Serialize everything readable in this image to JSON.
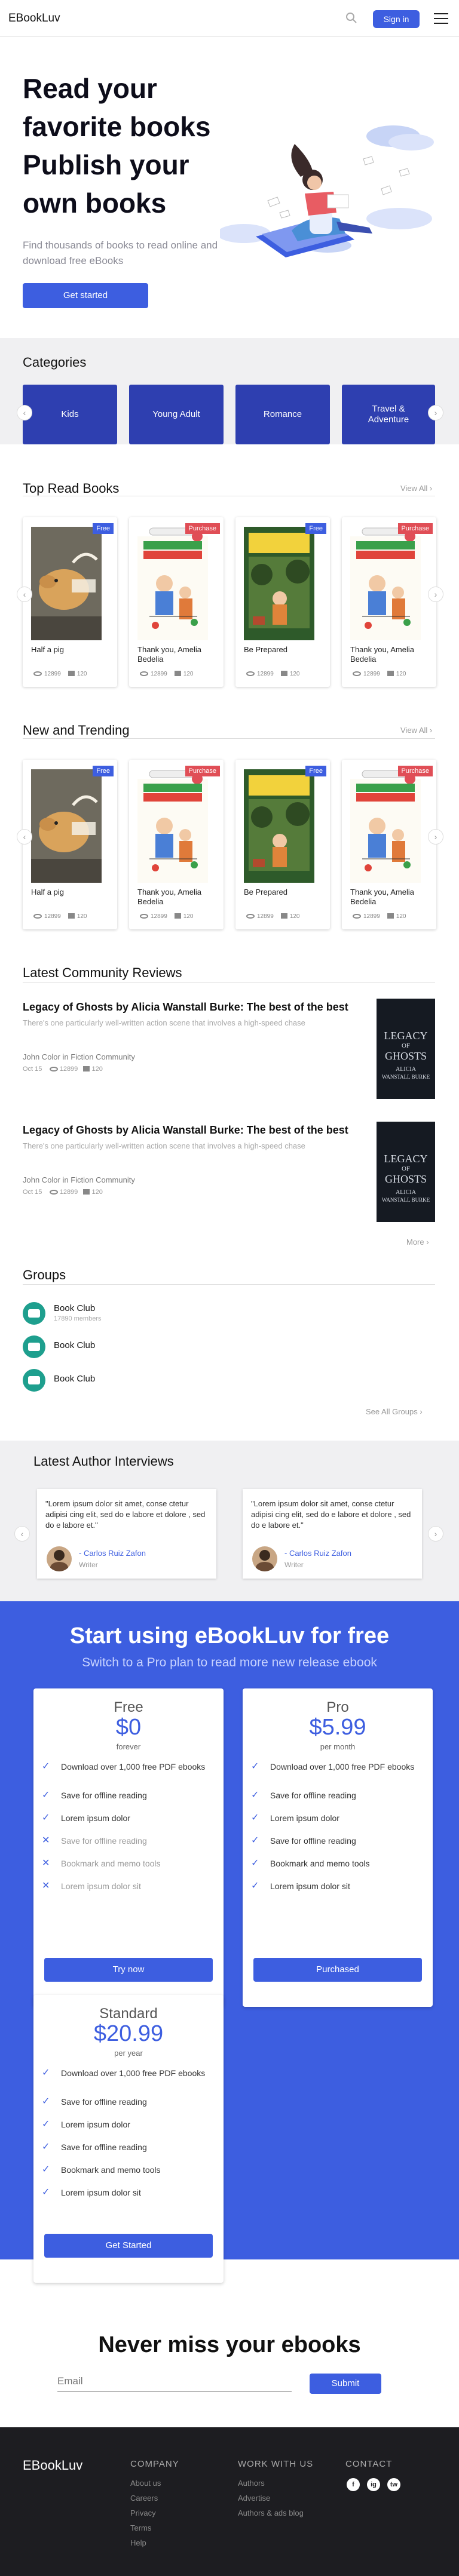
{
  "header": {
    "logo": "EBookLuv",
    "signin_label": "Sign in"
  },
  "hero": {
    "title_lines": [
      "Read your",
      "favorite books",
      "Publish your",
      "own books"
    ],
    "subtitle": "Find thousands of books to read online and download free eBooks",
    "cta_label": "Get started"
  },
  "categories": {
    "heading": "Categories",
    "items": [
      "Kids",
      "Young Adult",
      "Romance",
      "Travel & Adventure"
    ]
  },
  "top_read": {
    "heading": "Top Read Books",
    "view_all": "View All",
    "books": [
      {
        "tag": "Free",
        "title": "Half a pig",
        "views": "12899",
        "comments": "120"
      },
      {
        "tag": "Purchase",
        "title": "Thank you, Amelia Bedelia",
        "views": "12899",
        "comments": "120"
      },
      {
        "tag": "Free",
        "title": "Be Prepared",
        "views": "12899",
        "comments": "120"
      },
      {
        "tag": "Purchase",
        "title": "Thank you, Amelia Bedelia",
        "views": "12899",
        "comments": "120"
      }
    ]
  },
  "new_trending": {
    "heading": "New and Trending",
    "view_all": "View All",
    "books": [
      {
        "tag": "Free",
        "title": "Half a pig",
        "views": "12899",
        "comments": "120"
      },
      {
        "tag": "Purchase",
        "title": "Thank you, Amelia Bedelia",
        "views": "12899",
        "comments": "120"
      },
      {
        "tag": "Free",
        "title": "Be Prepared",
        "views": "12899",
        "comments": "120"
      },
      {
        "tag": "Purchase",
        "title": "Thank you, Amelia Bedelia",
        "views": "12899",
        "comments": "120"
      }
    ]
  },
  "reviews": {
    "heading": "Latest Community Reviews",
    "items": [
      {
        "title": "Legacy of Ghosts by Alicia Wanstall Burke: The best of the best",
        "excerpt": "There's one particularly well-written action scene that involves a high-speed chase",
        "author": "John Color in Fiction Community",
        "date": "Oct 15",
        "views": "12899",
        "comments": "120"
      },
      {
        "title": "Legacy of Ghosts by Alicia Wanstall Burke: The best of the best",
        "excerpt": "There's one particularly well-written action scene that involves a high-speed chase",
        "author": "John Color in Fiction Community",
        "date": "Oct 15",
        "views": "12899",
        "comments": "120"
      }
    ],
    "more": "More",
    "cover_lines": [
      "LEGACY",
      "OF",
      "GHOSTS",
      "ALICIA",
      "WANSTALL BURKE"
    ]
  },
  "groups": {
    "heading": "Groups",
    "items": [
      {
        "name": "Book Club",
        "members": "17890 members"
      },
      {
        "name": "Book Club"
      },
      {
        "name": "Book Club"
      }
    ],
    "see_all": "See All Groups"
  },
  "interviews": {
    "heading": "Latest Author Interviews",
    "items": [
      {
        "quote": "\"Lorem ipsum dolor sit amet, conse ctetur adipisi cing elit, sed do e labore et dolore , sed do e labore et.\"",
        "name": "- Carlos Ruiz Zafon",
        "role": "Writer"
      },
      {
        "quote": "\"Lorem ipsum dolor sit amet, conse ctetur adipisi cing elit, sed do e labore et dolore , sed do e labore et.\"",
        "name": "- Carlos Ruiz Zafon",
        "role": "Writer"
      }
    ]
  },
  "pricing": {
    "title": "Start using eBookLuv for free",
    "subtitle": "Switch to a Pro plan to read more new release ebook",
    "plans": [
      {
        "name": "Free",
        "price": "$0",
        "period": "forever",
        "button": "Try now",
        "features": [
          {
            "text": "Download over 1,000 free PDF ebooks",
            "on": true
          },
          {
            "text": "Save for offline reading",
            "on": true
          },
          {
            "text": "Lorem ipsum dolor",
            "on": true
          },
          {
            "text": "Save for offline reading",
            "on": false
          },
          {
            "text": "Bookmark and memo tools",
            "on": false
          },
          {
            "text": "Lorem ipsum dolor sit",
            "on": false
          }
        ]
      },
      {
        "name": "Pro",
        "price": "$5.99",
        "period": "per month",
        "button": "Purchased",
        "features": [
          {
            "text": "Download over 1,000 free PDF ebooks",
            "on": true
          },
          {
            "text": "Save for offline reading",
            "on": true
          },
          {
            "text": "Lorem ipsum dolor",
            "on": true
          },
          {
            "text": "Save for offline reading",
            "on": true
          },
          {
            "text": "Bookmark and memo tools",
            "on": true
          },
          {
            "text": "Lorem ipsum dolor sit",
            "on": true
          }
        ]
      },
      {
        "name": "Standard",
        "price": "$20.99",
        "period": "per year",
        "button": "Get Started",
        "features": [
          {
            "text": "Download over 1,000 free PDF ebooks",
            "on": true
          },
          {
            "text": "Save for offline reading",
            "on": true
          },
          {
            "text": "Lorem ipsum dolor",
            "on": true
          },
          {
            "text": "Save for offline reading",
            "on": true
          },
          {
            "text": "Bookmark and memo tools",
            "on": true
          },
          {
            "text": "Lorem ipsum dolor sit",
            "on": true
          }
        ]
      }
    ]
  },
  "newsletter": {
    "title": "Never miss your ebooks",
    "placeholder": "Email",
    "button": "Submit"
  },
  "footer": {
    "logo": "EBookLuv",
    "company": {
      "heading": "COMPANY",
      "links": [
        "About us",
        "Careers",
        "Privacy",
        "Terms",
        "Help"
      ]
    },
    "work": {
      "heading": "WORK WITH US",
      "links": [
        "Authors",
        "Advertise",
        "Authors & ads blog"
      ]
    },
    "contact": {
      "heading": "CONTACT",
      "social": [
        "f",
        "ig",
        "tw"
      ]
    }
  },
  "colors": {
    "brand": "#3d5ee0",
    "category": "#2e3fb0",
    "purchase": "#e04e56",
    "footer": "#1d1d21"
  },
  "icons": [
    "search-icon",
    "menu-icon",
    "chevron-left-icon",
    "chevron-right-icon",
    "eye-icon",
    "comment-icon",
    "check-icon",
    "x-icon",
    "facebook-icon",
    "instagram-icon",
    "twitter-icon"
  ]
}
